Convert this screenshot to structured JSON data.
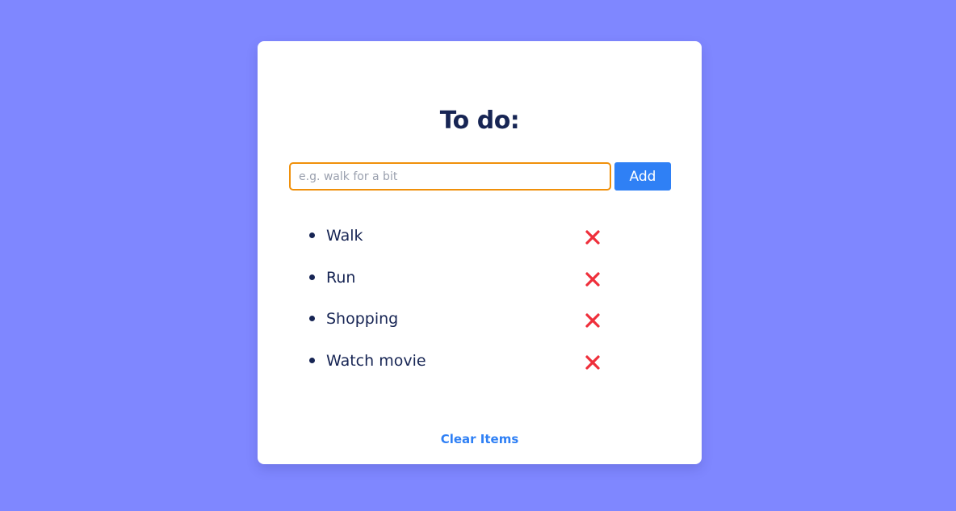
{
  "app": {
    "title": "To do:",
    "input": {
      "placeholder": "e.g. walk for a bit",
      "value": ""
    },
    "add_button_label": "Add",
    "delete_icon": "close-x-icon",
    "clear_label": "Clear Items",
    "items": [
      {
        "text": "Walk"
      },
      {
        "text": "Run"
      },
      {
        "text": "Shopping"
      },
      {
        "text": "Watch movie"
      }
    ]
  },
  "colors": {
    "background": "#7f87ff",
    "card": "#ffffff",
    "text": "#172554",
    "accent": "#2f80f5",
    "input_focus_border": "#f0900a",
    "delete": "#ef2f3b"
  }
}
